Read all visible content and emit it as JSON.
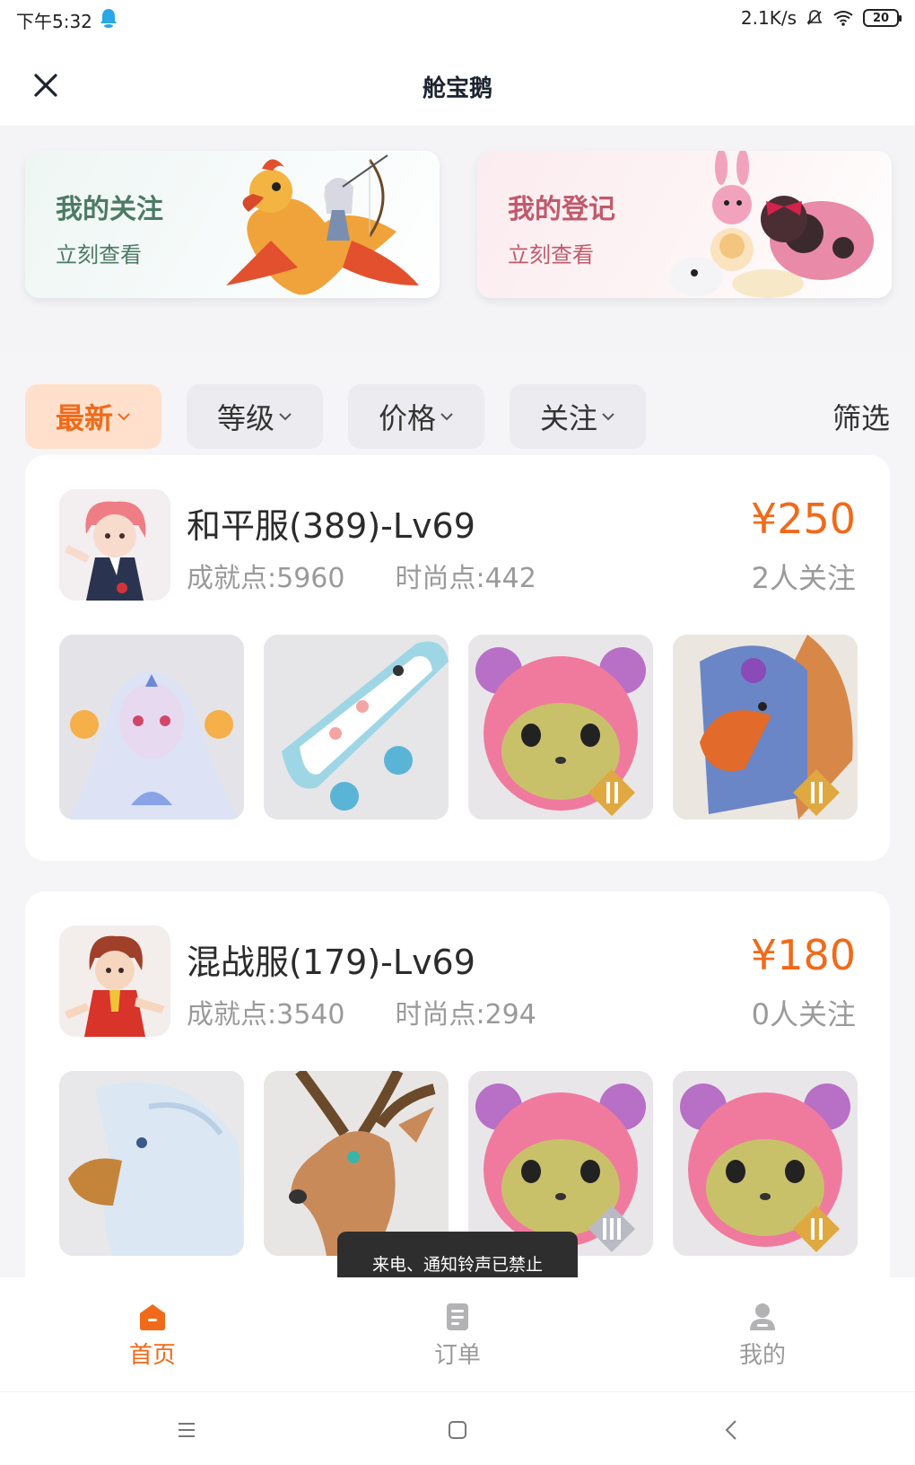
{
  "status_bar": {
    "time": "下午5:32",
    "network_speed": "2.1K/s",
    "battery": "20"
  },
  "header": {
    "title": "舱宝鹅"
  },
  "shortcuts": [
    {
      "title": "我的关注",
      "subtitle": "立刻查看"
    },
    {
      "title": "我的登记",
      "subtitle": "立刻查看"
    }
  ],
  "filters": {
    "chips": [
      {
        "label": "最新",
        "active": true
      },
      {
        "label": "等级",
        "active": false
      },
      {
        "label": "价格",
        "active": false
      },
      {
        "label": "关注",
        "active": false
      }
    ],
    "filter_link": "筛选"
  },
  "listings": [
    {
      "server": "和平服(389)-Lv69",
      "achievement": "成就点:5960",
      "fashion": "时尚点:442",
      "price": "¥250",
      "follows": "2人关注"
    },
    {
      "server": "混战服(179)-Lv69",
      "achievement": "成就点:3540",
      "fashion": "时尚点:294",
      "price": "¥180",
      "follows": "0人关注"
    }
  ],
  "toast": "来电、通知铃声已禁止",
  "tabs": [
    {
      "label": "首页",
      "icon": "home-icon",
      "active": true
    },
    {
      "label": "订单",
      "icon": "order-icon",
      "active": false
    },
    {
      "label": "我的",
      "icon": "profile-icon",
      "active": false
    }
  ],
  "colors": {
    "accent": "#f06a1a",
    "accent_light": "#ffe0cc",
    "follow_green": "#4c7a66",
    "register_pink": "#c05a6c"
  }
}
